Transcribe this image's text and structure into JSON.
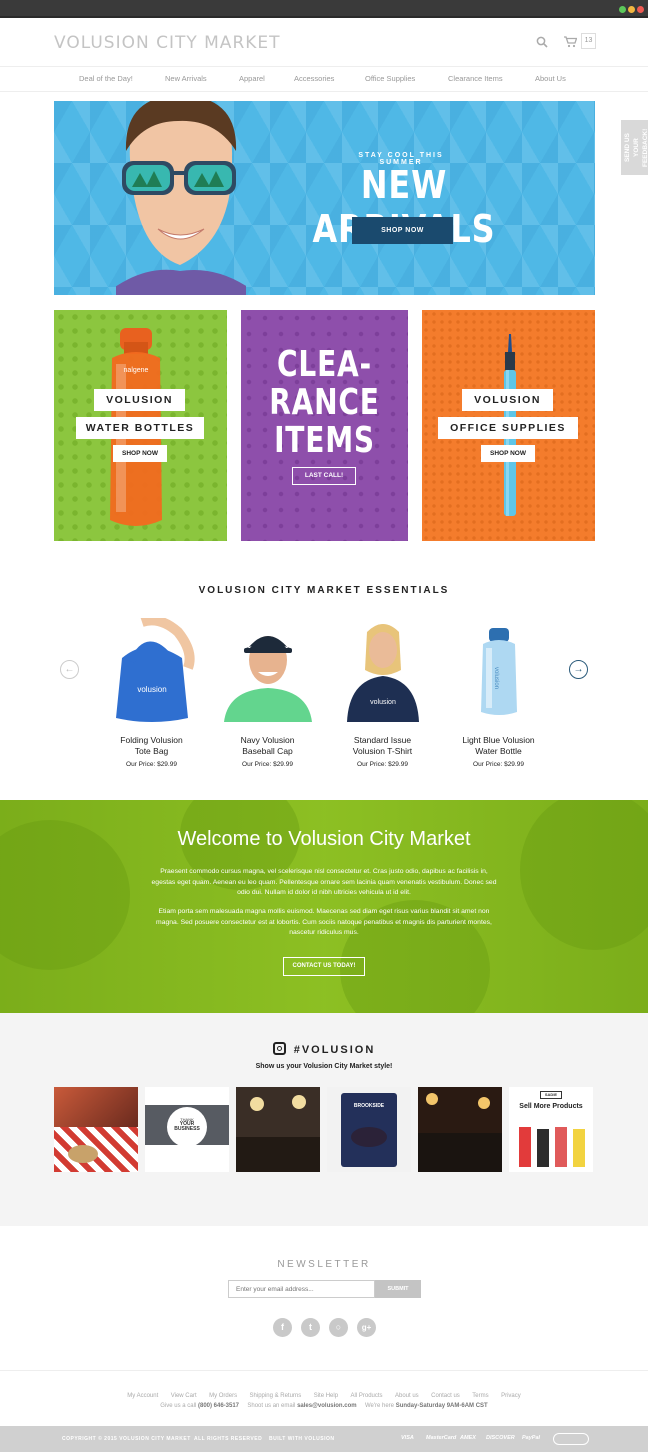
{
  "header": {
    "logo": "VOLUSION CITY MARKET",
    "cart_count": "13"
  },
  "nav": [
    "Deal of the Day!",
    "New Arrivals",
    "Apparel",
    "Accessories",
    "Office Supplies",
    "Clearance Items",
    "About Us"
  ],
  "hero": {
    "kicker": "STAY COOL THIS SUMMER",
    "title": "NEW ARRIVALS",
    "button": "SHOP NOW"
  },
  "feedback_tab": "SEND US YOUR FEEDBACK!",
  "promos": {
    "water": {
      "line1": "VOLUSION",
      "line2": "WATER BOTTLES",
      "button": "SHOP NOW"
    },
    "clearance": {
      "title1": "CLEA-",
      "title2": "RANCE",
      "title3": "ITEMS",
      "button": "LAST CALL!"
    },
    "office": {
      "line1": "VOLUSION",
      "line2": "OFFICE SUPPLIES",
      "button": "SHOP NOW"
    }
  },
  "essentials": {
    "title": "VOLUSION CITY MARKET ESSENTIALS",
    "products": [
      {
        "name1": "Folding Volusion",
        "name2": "Tote Bag",
        "price": "Our Price: $29.99"
      },
      {
        "name1": "Navy Volusion",
        "name2": "Baseball Cap",
        "price": "Our Price: $29.99"
      },
      {
        "name1": "Standard Issue",
        "name2": "Volusion T-Shirt",
        "price": "Our Price: $29.99"
      },
      {
        "name1": "Light Blue Volusion",
        "name2": "Water Bottle",
        "price": "Our Price: $29.99"
      }
    ]
  },
  "welcome": {
    "title": "Welcome to Volusion City Market",
    "p1": "Praesent commodo cursus magna, vel scelerisque nisl consectetur et. Cras justo odio, dapibus ac facilisis in, egestas eget quam. Aenean eu leo quam. Pellentesque ornare sem lacinia quam venenatis vestibulum. Donec sed odio dui. Nullam id dolor id nibh ultricies vehicula ut id elit.",
    "p2": "Etiam porta sem malesuada magna mollis euismod. Maecenas sed diam eget risus varius blandit sit amet non magna. Sed posuere consectetur est at lobortis. Cum sociis natoque penatibus et magnis dis parturient montes, nascetur ridiculus mus.",
    "button": "CONTACT US TODAY!"
  },
  "instagram": {
    "title": "#VOLUSION",
    "subtitle": "Show us your Volusion City Market style!",
    "thumb2_text1": "THANK",
    "thumb2_text2": "YOUR BUSINESS",
    "thumb4_text": "BROOKSIDE",
    "thumb6_brand": "SADIE",
    "thumb6_text": "Sell More Products"
  },
  "newsletter": {
    "title": "NEWSLETTER",
    "placeholder": "Enter your email address...",
    "button": "SUBMIT"
  },
  "footer": {
    "links": [
      "My Account",
      "View Cart",
      "My Orders",
      "Shipping & Returns",
      "Site Help",
      "All Products",
      "About us",
      "Contact us",
      "Terms",
      "Privacy"
    ],
    "call_prefix": "Give us a call",
    "phone": "(800) 646-3517",
    "email_prefix": "Shoot us an email",
    "email": "sales@volusion.com",
    "hours_prefix": "We're here",
    "hours": "Sunday-Saturday 9AM-6AM CST"
  },
  "bottom_bar": {
    "copyright": "COPYRIGHT © 2015 VOLUSION CITY MARKET",
    "rights": "ALL RIGHTS RESERVED",
    "built": "BUILT WITH VOLUSION",
    "payments": [
      "VISA",
      "MasterCard",
      "AMEX",
      "DISCOVER",
      "PayPal"
    ]
  },
  "colors": {
    "hero_bg": "#4fb8e6",
    "green": "#8cc63f",
    "purple": "#8e4fab",
    "orange": "#f47c2c",
    "navy": "#1a4a6e"
  }
}
